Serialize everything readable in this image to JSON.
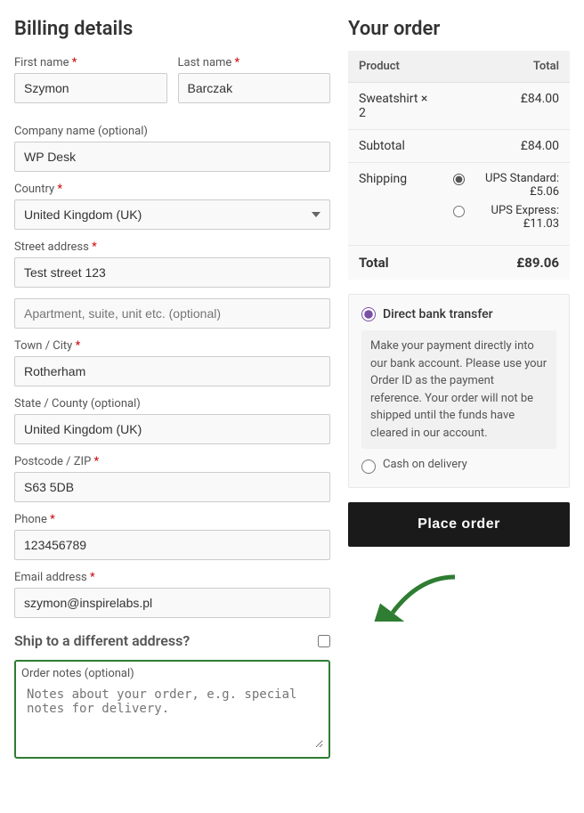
{
  "billing": {
    "title": "Billing details",
    "first_name_label": "First name",
    "first_name_value": "Szymon",
    "last_name_label": "Last name",
    "last_name_value": "Barczak",
    "company_label": "Company name (optional)",
    "company_value": "WP Desk",
    "country_label": "Country",
    "country_value": "United Kingdom (UK)",
    "street_label": "Street address",
    "street_value": "Test street 123",
    "apartment_placeholder": "Apartment, suite, unit etc. (optional)",
    "city_label": "Town / City",
    "city_value": "Rotherham",
    "state_label": "State / County (optional)",
    "state_value": "United Kingdom (UK)",
    "postcode_label": "Postcode / ZIP",
    "postcode_value": "S63 5DB",
    "phone_label": "Phone",
    "phone_value": "123456789",
    "email_label": "Email address",
    "email_value": "szymon@inspirelabs.pl"
  },
  "ship_different": {
    "label": "Ship to a different address?"
  },
  "order_notes": {
    "label": "Order notes (optional)",
    "placeholder": "Notes about your order, e.g. special notes for delivery."
  },
  "order": {
    "title": "Your order",
    "product_col": "Product",
    "total_col": "Total",
    "item_name": "Sweatshirt × 2",
    "item_total": "£84.00",
    "subtotal_label": "Subtotal",
    "subtotal_value": "£84.00",
    "shipping_label": "Shipping",
    "shipping_options": [
      {
        "label": "UPS Standard: £5.06",
        "checked": true
      },
      {
        "label": "UPS Express: £11.03",
        "checked": false
      }
    ],
    "total_label": "Total",
    "total_value": "£89.06"
  },
  "payment": {
    "direct_bank_label": "Direct bank transfer",
    "direct_bank_description": "Make your payment directly into our bank account. Please use your Order ID as the payment reference. Your order will not be shipped until the funds have cleared in our account.",
    "cash_label": "Cash on delivery"
  },
  "place_order_btn": "Place order",
  "colors": {
    "accent_purple": "#7b4fa6",
    "accent_green": "#2e7d32",
    "link_blue": "#0073aa"
  }
}
